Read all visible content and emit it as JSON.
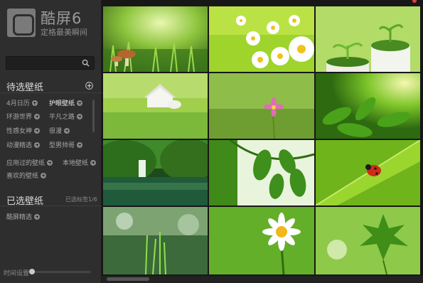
{
  "app": {
    "title": "酷屏6",
    "subtitle": "定格最美瞬间"
  },
  "search": {
    "placeholder": "",
    "value": ""
  },
  "pending": {
    "title": "待选壁纸",
    "categories": [
      {
        "label": "4月日历",
        "active": false
      },
      {
        "label": "护眼壁纸",
        "active": true
      },
      {
        "label": "环游世界",
        "active": false
      },
      {
        "label": "平凡之路",
        "active": false
      },
      {
        "label": "性感女神",
        "active": false
      },
      {
        "label": "很漫",
        "active": false
      },
      {
        "label": "动漫精选",
        "active": false
      },
      {
        "label": "型男帅哥",
        "active": false
      }
    ],
    "extras": [
      {
        "label": "应用过的壁纸"
      },
      {
        "label": "本地壁纸"
      },
      {
        "label": "喜欢的壁纸"
      }
    ]
  },
  "selected": {
    "title": "已选壁纸",
    "count_text": "已选标签1/6",
    "items": [
      {
        "label": "酷屏精选"
      }
    ]
  },
  "time_setting": {
    "label": "时间设置",
    "level": 0
  },
  "colors": {
    "sidebar_bg": "#2e2e2e",
    "grid_bg": "#171717",
    "accent_green": "#7cc43a",
    "close_red": "#e03a3a"
  },
  "wallpapers": [
    {
      "name": "mushrooms-in-grass"
    },
    {
      "name": "white-daisies"
    },
    {
      "name": "sprouts-in-pots"
    },
    {
      "name": "little-white-house-on-grass"
    },
    {
      "name": "pink-flower-in-grass"
    },
    {
      "name": "green-tea-leaves"
    },
    {
      "name": "waterfall-forest-lake"
    },
    {
      "name": "green-vine-leaves"
    },
    {
      "name": "ladybug-on-leaf"
    },
    {
      "name": "grass-blades-bokeh"
    },
    {
      "name": "white-daisy"
    },
    {
      "name": "maple-leaves"
    }
  ]
}
